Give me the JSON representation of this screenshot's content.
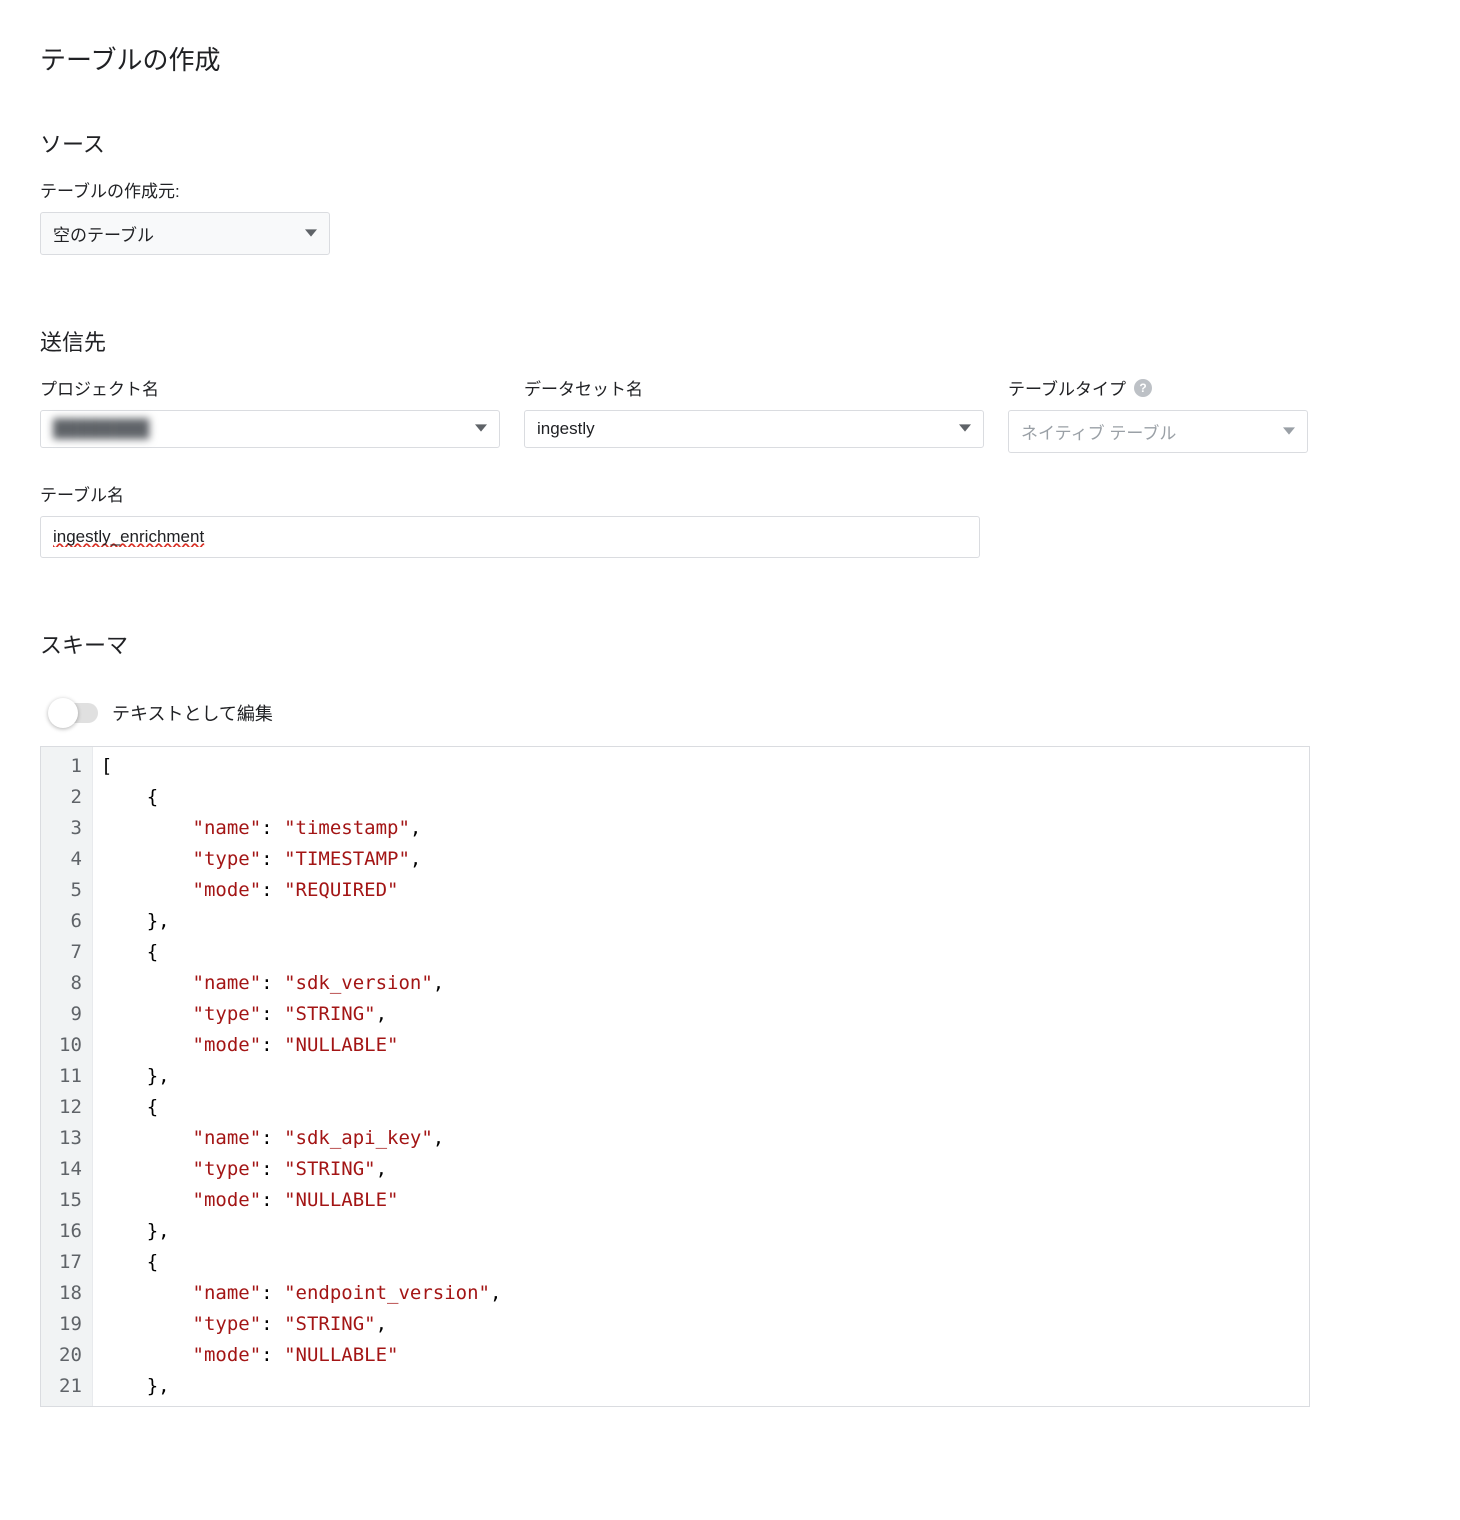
{
  "page": {
    "title": "テーブルの作成"
  },
  "source": {
    "heading": "ソース",
    "create_from_label": "テーブルの作成元:",
    "create_from_value": "空のテーブル"
  },
  "destination": {
    "heading": "送信先",
    "project_label": "プロジェクト名",
    "project_value": "████████",
    "dataset_label": "データセット名",
    "dataset_value": "ingestly",
    "tabletype_label": "テーブルタイプ",
    "tabletype_value": "ネイティブ テーブル",
    "tablename_label": "テーブル名",
    "tablename_value": "ingestly_enrichment"
  },
  "schema": {
    "heading": "スキーマ",
    "edit_as_text_label": "テキストとして編集",
    "code_lines": [
      "[",
      "    {",
      "        \"name\": \"timestamp\",",
      "        \"type\": \"TIMESTAMP\",",
      "        \"mode\": \"REQUIRED\"",
      "    },",
      "    {",
      "        \"name\": \"sdk_version\",",
      "        \"type\": \"STRING\",",
      "        \"mode\": \"NULLABLE\"",
      "    },",
      "    {",
      "        \"name\": \"sdk_api_key\",",
      "        \"type\": \"STRING\",",
      "        \"mode\": \"NULLABLE\"",
      "    },",
      "    {",
      "        \"name\": \"endpoint_version\",",
      "        \"type\": \"STRING\",",
      "        \"mode\": \"NULLABLE\"",
      "    },"
    ]
  }
}
